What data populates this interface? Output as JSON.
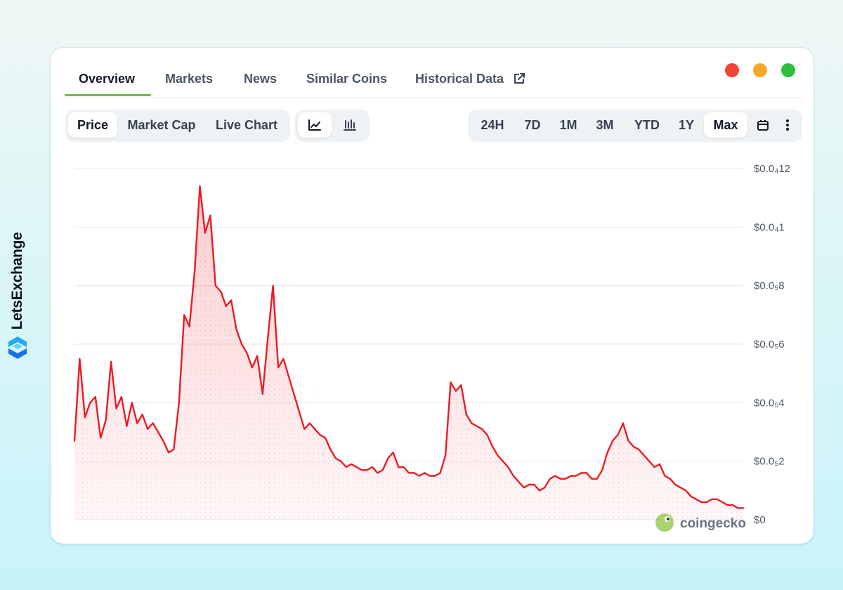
{
  "brand": {
    "name": "LetsExchange",
    "logo_icon": "letsexchange-logo-icon"
  },
  "window_controls": [
    {
      "name": "close",
      "color": "#f04438"
    },
    {
      "name": "minimize",
      "color": "#f7a72a"
    },
    {
      "name": "maximize",
      "color": "#2fbf3f"
    }
  ],
  "tabs": [
    {
      "label": "Overview",
      "active": true
    },
    {
      "label": "Markets"
    },
    {
      "label": "News"
    },
    {
      "label": "Similar Coins"
    },
    {
      "label": "Historical Data",
      "icon": "external-link-icon"
    }
  ],
  "metric_toggle": {
    "options": [
      "Price",
      "Market Cap",
      "Live Chart"
    ],
    "selected": "Price"
  },
  "chart_type_toggle": {
    "options": [
      "line-chart-icon",
      "candlestick-icon"
    ],
    "selected": "line-chart-icon"
  },
  "range_toggle": {
    "options": [
      "24H",
      "7D",
      "1M",
      "3M",
      "YTD",
      "1Y",
      "Max"
    ],
    "selected": "Max",
    "extra_icons": [
      "calendar-icon",
      "more-vertical-icon"
    ]
  },
  "watermark": "coingecko",
  "colors": {
    "line": "#ea1c24",
    "accent_tab": "#6ac046"
  },
  "chart_data": {
    "type": "area",
    "title": "",
    "xlabel": "",
    "ylabel": "",
    "ylim": [
      0,
      1.2e-06
    ],
    "y_ticks": [
      {
        "value": 1.2e-06,
        "label": "$0.0₄12"
      },
      {
        "value": 1e-06,
        "label": "$0.0₄1"
      },
      {
        "value": 8e-07,
        "label": "$0.0₅8"
      },
      {
        "value": 6e-07,
        "label": "$0.0₅6"
      },
      {
        "value": 4e-07,
        "label": "$0.0₅4"
      },
      {
        "value": 2e-07,
        "label": "$0.0₅2"
      },
      {
        "value": 0,
        "label": "$0"
      }
    ],
    "grid": true,
    "legend": "none",
    "y_axis_position": "right",
    "series": [
      {
        "values": [
          2.7e-07,
          5.5e-07,
          3.5e-07,
          4e-07,
          4.2e-07,
          2.8e-07,
          3.4e-07,
          5.4e-07,
          3.8e-07,
          4.2e-07,
          3.2e-07,
          4e-07,
          3.3e-07,
          3.6e-07,
          3.1e-07,
          3.3e-07,
          3e-07,
          2.7e-07,
          2.3e-07,
          2.4e-07,
          4e-07,
          7e-07,
          6.6e-07,
          8.5e-07,
          1.14e-06,
          9.8e-07,
          1.04e-06,
          8e-07,
          7.8e-07,
          7.3e-07,
          7.5e-07,
          6.5e-07,
          6e-07,
          5.7e-07,
          5.2e-07,
          5.6e-07,
          4.3e-07,
          6.2e-07,
          8e-07,
          5.2e-07,
          5.5e-07,
          4.9e-07,
          4.3e-07,
          3.7e-07,
          3.1e-07,
          3.3e-07,
          3.1e-07,
          2.9e-07,
          2.8e-07,
          2.4e-07,
          2.1e-07,
          2e-07,
          1.8e-07,
          1.9e-07,
          1.8e-07,
          1.7e-07,
          1.7e-07,
          1.8e-07,
          1.6e-07,
          1.7e-07,
          2.1e-07,
          2.3e-07,
          1.8e-07,
          1.8e-07,
          1.6e-07,
          1.6e-07,
          1.5e-07,
          1.6e-07,
          1.5e-07,
          1.5e-07,
          1.6e-07,
          2.2e-07,
          4.7e-07,
          4.4e-07,
          4.6e-07,
          3.6e-07,
          3.3e-07,
          3.2e-07,
          3.1e-07,
          2.9e-07,
          2.5e-07,
          2.2e-07,
          2e-07,
          1.8e-07,
          1.5e-07,
          1.3e-07,
          1.1e-07,
          1.2e-07,
          1.2e-07,
          1e-07,
          1.1e-07,
          1.4e-07,
          1.5e-07,
          1.4e-07,
          1.4e-07,
          1.5e-07,
          1.5e-07,
          1.6e-07,
          1.6e-07,
          1.4e-07,
          1.4e-07,
          1.7e-07,
          2.3e-07,
          2.7e-07,
          2.9e-07,
          3.3e-07,
          2.7e-07,
          2.5e-07,
          2.4e-07,
          2.2e-07,
          2e-07,
          1.8e-07,
          1.9e-07,
          1.5e-07,
          1.4e-07,
          1.2e-07,
          1.1e-07,
          1e-07,
          8e-08,
          7e-08,
          6e-08,
          6e-08,
          7e-08,
          7e-08,
          6e-08,
          5e-08,
          5e-08,
          4e-08,
          4e-08
        ]
      }
    ]
  }
}
